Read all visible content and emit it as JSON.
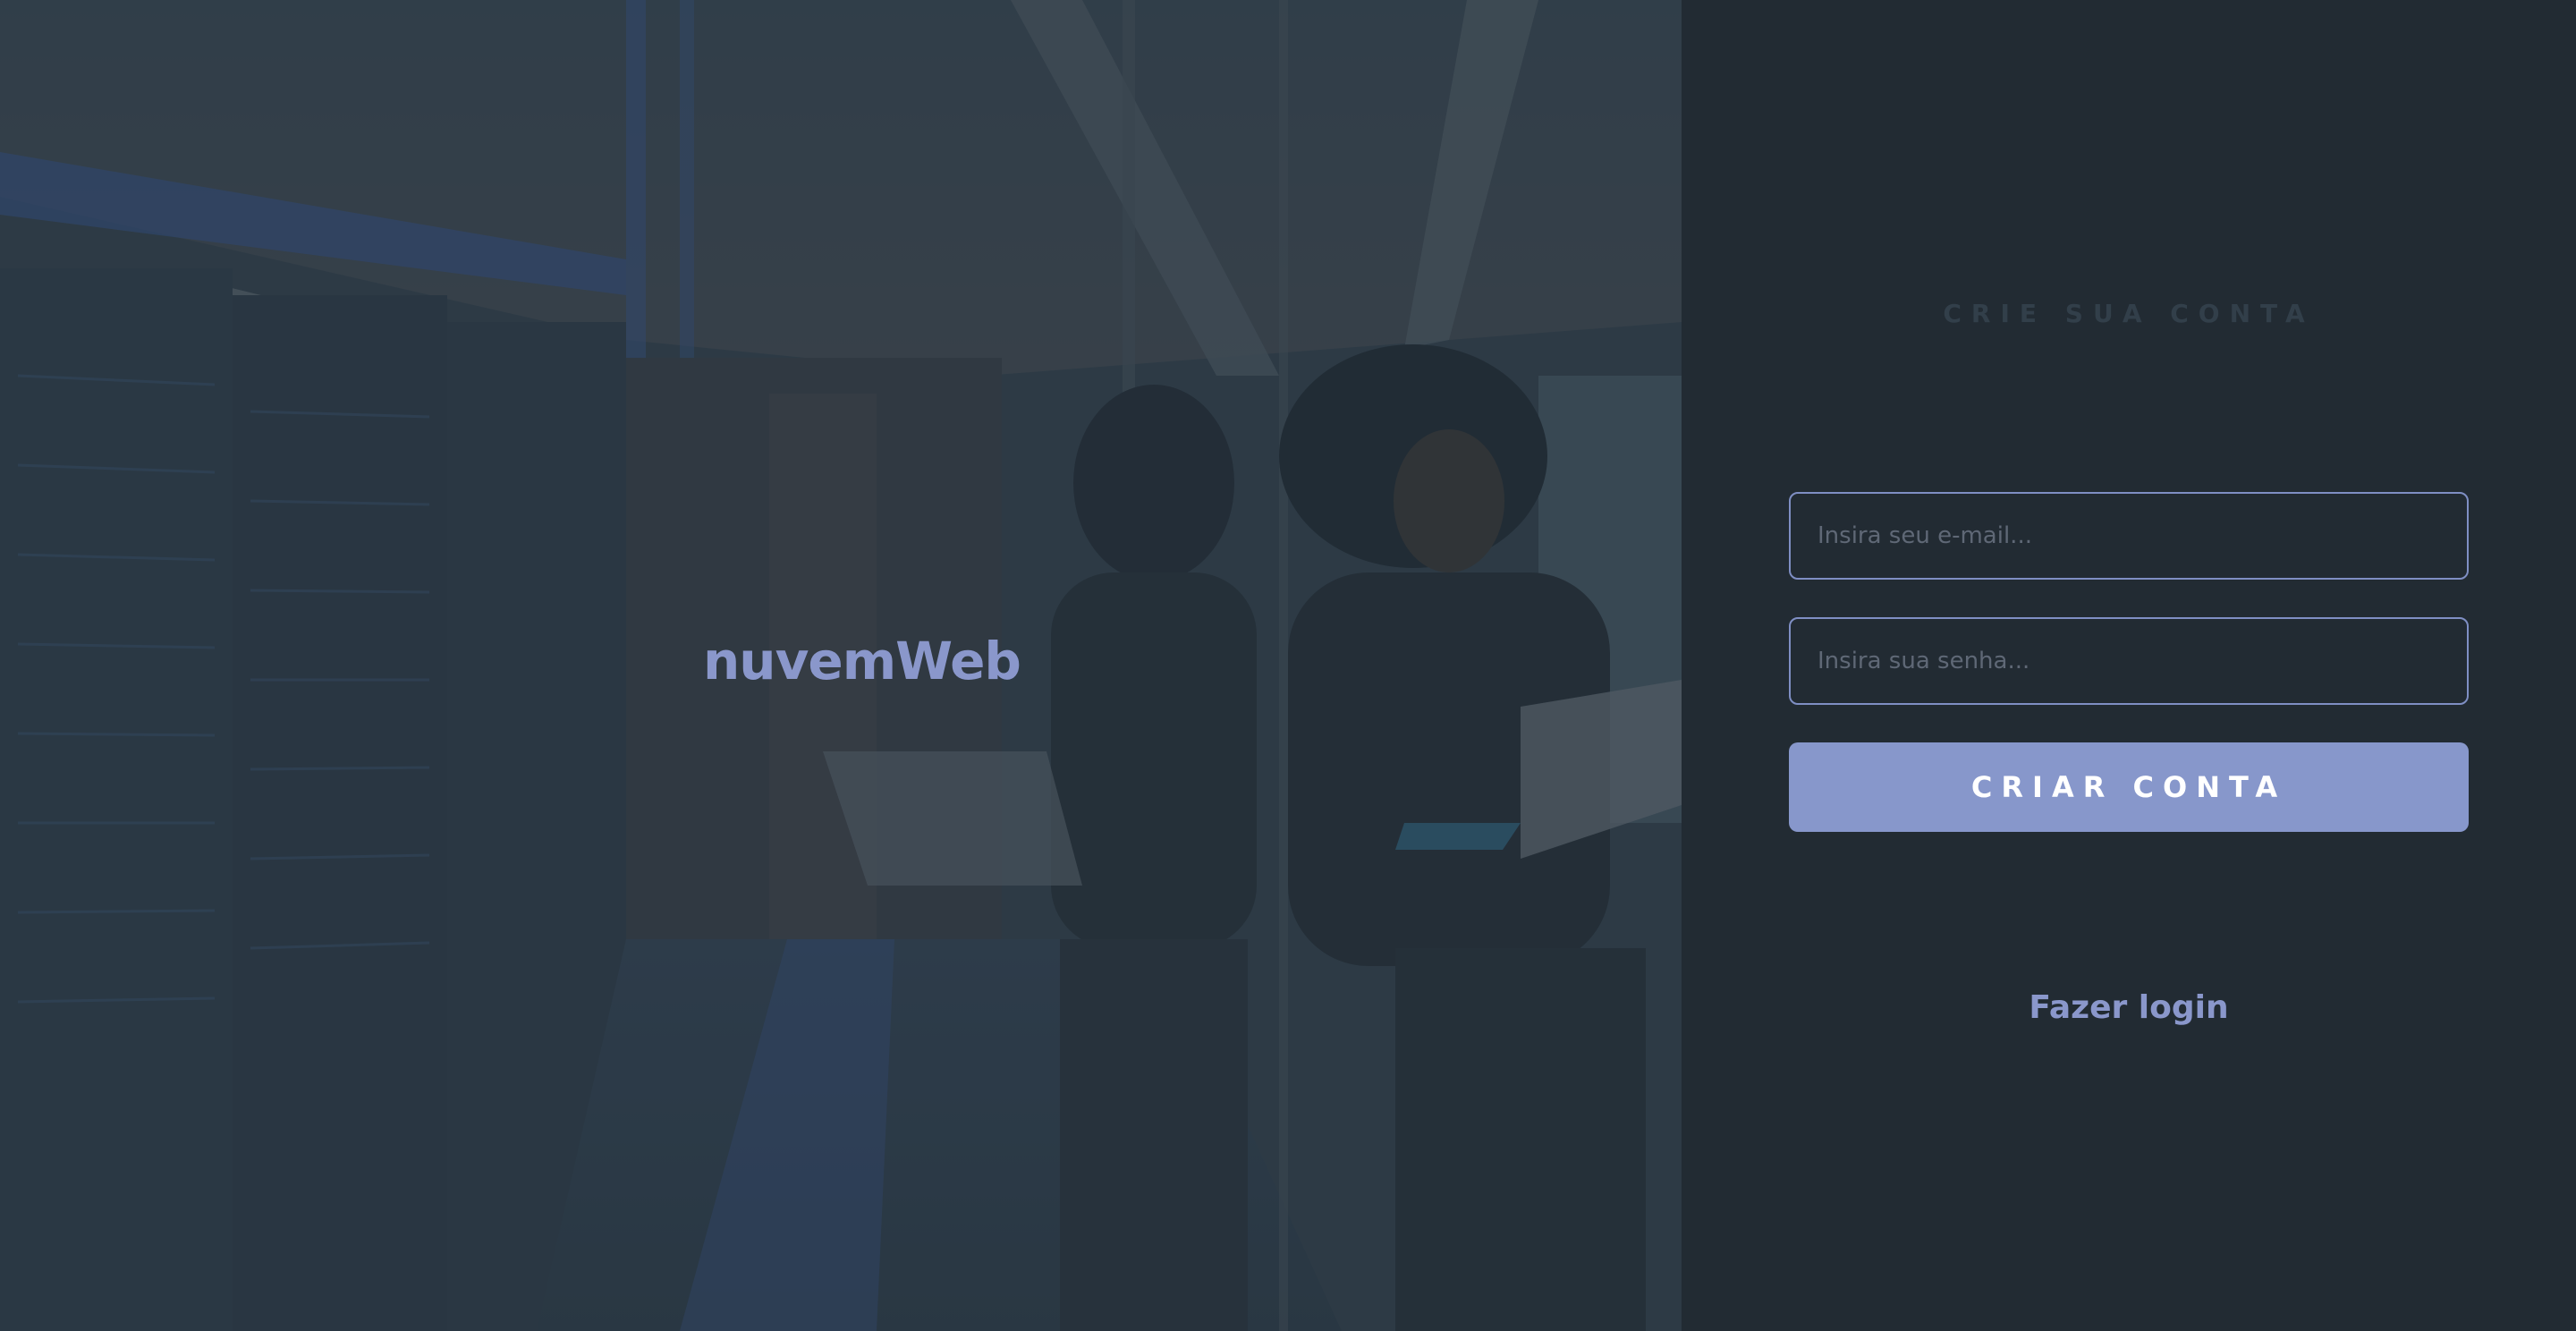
{
  "hero": {
    "brand": "nuvemWeb",
    "image_icon": "data-center-photo"
  },
  "form": {
    "title": "CRIE SUA CONTA",
    "email_placeholder": "Insira seu e-mail...",
    "password_placeholder": "Insira sua senha...",
    "submit_label": "CRIAR CONTA",
    "login_link": "Fazer login"
  },
  "colors": {
    "panel_bg": "#222b33",
    "accent": "#8797cb",
    "title_muted": "#323f4a"
  }
}
